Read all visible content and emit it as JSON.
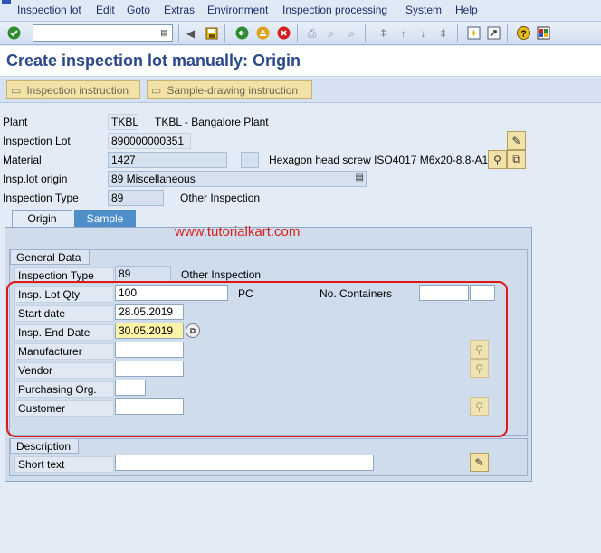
{
  "menu": {
    "items": [
      "Inspection lot",
      "Edit",
      "Goto",
      "Extras",
      "Environment",
      "Inspection processing",
      "System",
      "Help"
    ]
  },
  "toolbar": {
    "command_value": "",
    "icons": [
      "check-icon",
      "save-icon",
      "back-icon",
      "exit-icon",
      "cancel-icon",
      "print-icon",
      "find-icon",
      "find-next-icon",
      "first-page-icon",
      "previous-page-icon",
      "next-page-icon",
      "last-page-icon",
      "create-session-icon",
      "shortcut-icon",
      "help-icon",
      "layout-icon"
    ]
  },
  "title": "Create inspection lot manually: Origin",
  "app_toolbar": {
    "inspection_instruction": "Inspection instruction",
    "sample_drawing_instruction": "Sample-drawing instruction"
  },
  "header": {
    "plant_label": "Plant",
    "plant_value": "TKBL",
    "plant_desc": "TKBL - Bangalore Plant",
    "lot_label": "Inspection Lot",
    "lot_value": "890000000351",
    "material_label": "Material",
    "material_value": "1427",
    "material_desc": "Hexagon head screw ISO4017 M6x20-8.8-A1",
    "origin_label": "Insp.lot origin",
    "origin_value": "89 Miscellaneous",
    "type_label": "Inspection Type",
    "type_value": "89",
    "type_desc": "Other Inspection"
  },
  "tabs": {
    "origin": "Origin",
    "sample": "Sample"
  },
  "watermark": "www.tutorialkart.com",
  "general": {
    "title": "General Data",
    "type_label": "Inspection Type",
    "type_value": "89",
    "type_desc": "Other Inspection",
    "qty_label": "Insp. Lot Qty",
    "qty_value": "100",
    "qty_unit": "PC",
    "containers_label": "No. Containers",
    "containers_value": "",
    "containers_unit": "",
    "start_label": "Start date",
    "start_value": "28.05.2019",
    "end_label": "Insp. End Date",
    "end_value": "30.05.2019",
    "manufacturer_label": "Manufacturer",
    "manufacturer_value": "",
    "vendor_label": "Vendor",
    "vendor_value": "",
    "porg_label": "Purchasing Org.",
    "porg_value": "",
    "customer_label": "Customer",
    "customer_value": ""
  },
  "description": {
    "title": "Description",
    "short_label": "Short text",
    "short_value": ""
  },
  "colors": {
    "title": "#2c4a8a",
    "highlight": "#e01818",
    "watermark": "#d6221d",
    "active_tab": "#4e8fc9"
  }
}
